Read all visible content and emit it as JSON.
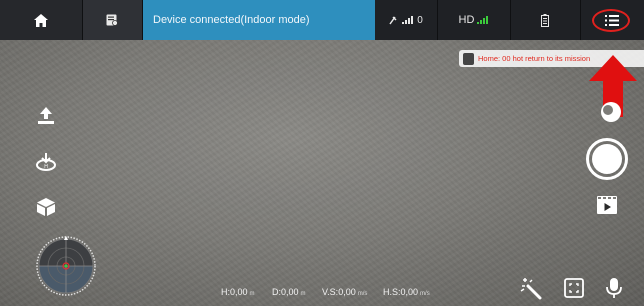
{
  "status_bar": {
    "connection_status": "Device connected(Indoor mode)",
    "signal_value": "0",
    "hd_label": "HD",
    "icons": {
      "home": "home-icon",
      "flight_log": "flight-log-icon",
      "rc_signal": "rc-signal-icon",
      "hd_signal": "hd-signal-icon",
      "battery": "battery-icon",
      "menu": "menu-list-icon"
    }
  },
  "tip": {
    "text": "Home: 00 hot return to its mission"
  },
  "annotation": {
    "circle_color": "#e0211e",
    "arrow_color": "#e01010"
  },
  "left_controls": [
    {
      "name": "takeoff",
      "icon": "takeoff-icon"
    },
    {
      "name": "return-home",
      "icon": "return-home-icon"
    },
    {
      "name": "intelligent-flight-mode",
      "icon": "cube-icon"
    }
  ],
  "telemetry": [
    {
      "label": "H:",
      "value": "0,00",
      "unit": "m"
    },
    {
      "label": "D:",
      "value": "0,00",
      "unit": "m"
    },
    {
      "label": "V.S:",
      "value": "0,00",
      "unit": "m/s"
    },
    {
      "label": "H.S:",
      "value": "0,00",
      "unit": "m/s"
    }
  ],
  "colors": {
    "status_accent": "#2e8fbe",
    "topbar": "#1f2125",
    "hd_signal": "#3ccc3c",
    "tip_text": "#e02a20"
  }
}
